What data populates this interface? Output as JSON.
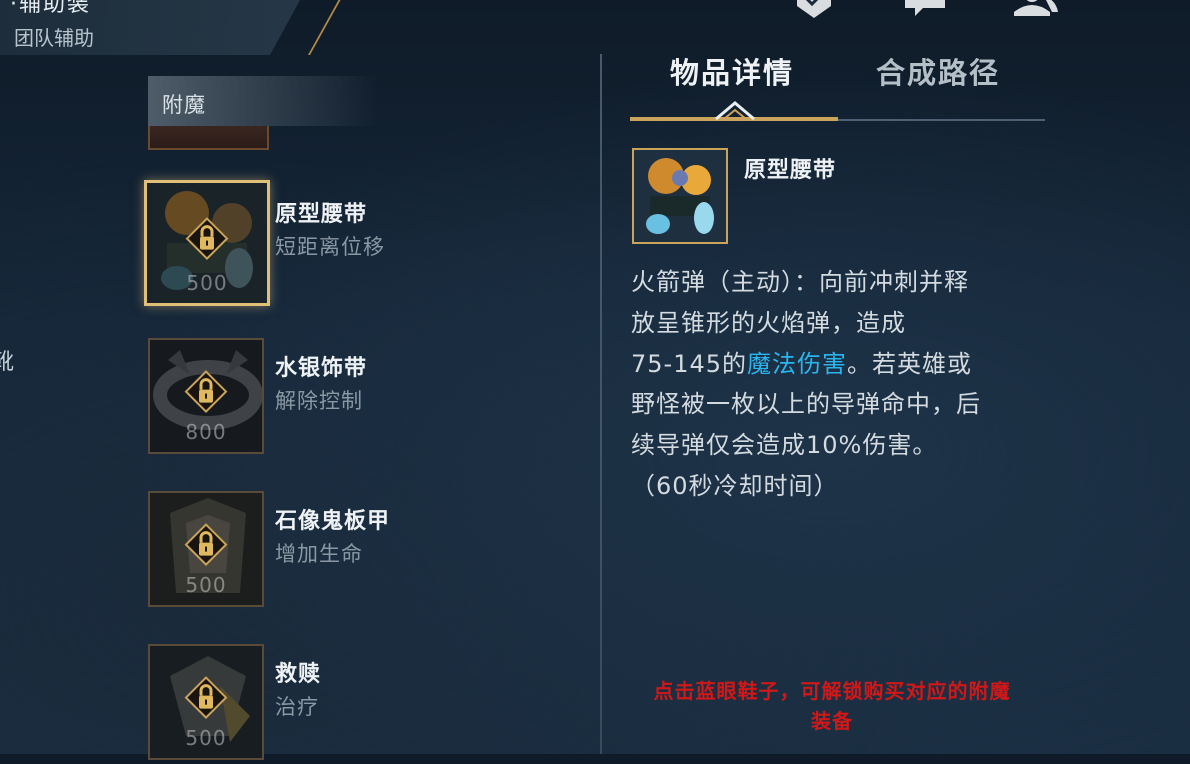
{
  "header": {
    "title_fragment": "·辅助装",
    "role": "团队辅助"
  },
  "left_edge_fragment": "靴",
  "category": {
    "label": "附魔"
  },
  "items": [
    {
      "name": "原型腰带",
      "effect": "短距离位移",
      "price": "500",
      "selected": true,
      "locked": true,
      "icon": "rocket-belt-art"
    },
    {
      "name": "水银饰带",
      "effect": "解除控制",
      "price": "800",
      "selected": false,
      "locked": true,
      "icon": "mercury-sash-art"
    },
    {
      "name": "石像鬼板甲",
      "effect": "增加生命",
      "price": "500",
      "selected": false,
      "locked": true,
      "icon": "gargoyle-plate-art"
    },
    {
      "name": "救赎",
      "effect": "治疗",
      "price": "500",
      "selected": false,
      "locked": true,
      "icon": "redemption-art"
    }
  ],
  "tabs": [
    {
      "label": "物品详情",
      "active": true
    },
    {
      "label": "合成路径",
      "active": false
    }
  ],
  "detail": {
    "name": "原型腰带",
    "lines": [
      "火箭弹（主动）：向前冲刺并释",
      "放呈锥形的火焰弹，造成",
      "75-145的",
      "魔法伤害",
      "。若英雄或",
      "野怪被一枚以上的导弹命中，后",
      "续导弹仅会造成10%伤害。",
      "（60秒冷却时间）"
    ]
  },
  "note": {
    "line1": "点击蓝眼鞋子，可解锁购买对应的附魔",
    "line2": "装备"
  },
  "icons": [
    "check-shield-icon",
    "chat-icon",
    "friends-icon",
    "lock-icon",
    "caret-up-icon"
  ],
  "colors": {
    "gold": "#c9a45a",
    "highlight_blue": "#2bb4ee",
    "note_red": "#d01818"
  }
}
